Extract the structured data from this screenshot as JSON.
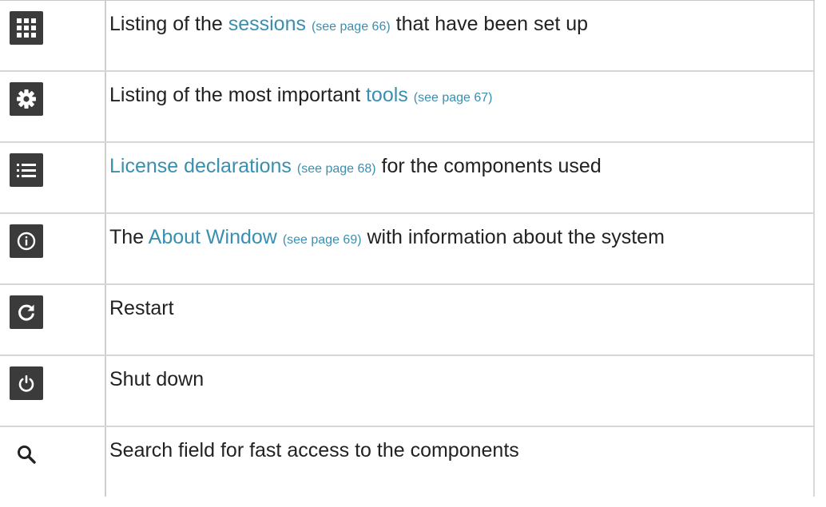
{
  "colors": {
    "link": "#3a8fb0",
    "icon_bg": "#3b3b3b",
    "text": "#222222"
  },
  "rows": [
    {
      "icon": "grid-icon",
      "pre": "Listing of the ",
      "link": "sessions",
      "ref": "(see page 66)",
      "post": " that have been set up"
    },
    {
      "icon": "gear-icon",
      "pre": "Listing of the most important ",
      "link": "tools",
      "ref": "(see page 67)",
      "post": ""
    },
    {
      "icon": "list-icon",
      "pre": "",
      "link": "License declarations",
      "ref": "(see page 68)",
      "post": " for the components used"
    },
    {
      "icon": "info-icon",
      "pre": "The ",
      "link": "About Window",
      "ref": "(see page 69)",
      "post": " with information about the system"
    },
    {
      "icon": "restart-icon",
      "text": "Restart"
    },
    {
      "icon": "power-icon",
      "text": "Shut down"
    },
    {
      "icon": "search-icon",
      "text": "Search field for fast access to the components"
    }
  ]
}
